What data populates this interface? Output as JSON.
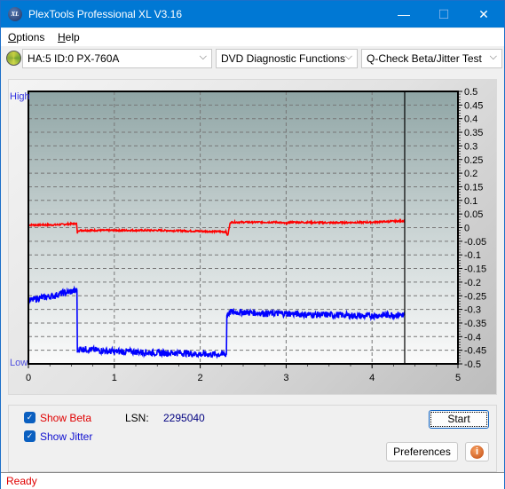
{
  "window": {
    "title": "PlexTools Professional XL V3.16",
    "icon_label": "XL",
    "minimize_glyph": "—",
    "maximize_glyph": "☐",
    "close_glyph": "✕"
  },
  "menu": {
    "items": [
      {
        "label": "Options",
        "accel": "O",
        "rest": "ptions"
      },
      {
        "label": "Help",
        "accel": "H",
        "rest": "elp"
      }
    ]
  },
  "toolbar": {
    "drive_select": "HA:5 ID:0  PX-760A",
    "function_select": "DVD Diagnostic Functions",
    "test_select": "Q-Check Beta/Jitter Test",
    "chevron": "⌵"
  },
  "chart_data": {
    "type": "line",
    "title": "",
    "xlabel": "",
    "ylabel": "",
    "left_label_high": "High",
    "left_label_low": "Low",
    "xlim": [
      0,
      5
    ],
    "ylim": [
      -0.5,
      0.5
    ],
    "x_ticks": [
      "0",
      "1",
      "2",
      "3",
      "4",
      "5"
    ],
    "y_ticks": [
      "0.5",
      "0.45",
      "0.4",
      "0.35",
      "0.3",
      "0.25",
      "0.2",
      "0.15",
      "0.1",
      "0.05",
      "0",
      "-0.05",
      "-0.1",
      "-0.15",
      "-0.2",
      "-0.25",
      "-0.3",
      "-0.35",
      "-0.4",
      "-0.45",
      "-0.5"
    ],
    "grid": true,
    "cursor_x": 4.38,
    "series": [
      {
        "name": "Beta",
        "color": "#ff0000",
        "x": [
          0.0,
          0.3,
          0.56,
          0.57,
          0.58,
          1.0,
          1.5,
          2.0,
          2.3,
          2.32,
          2.35,
          2.5,
          2.9,
          3.0,
          3.05,
          3.5,
          4.0,
          4.38
        ],
        "y": [
          0.01,
          0.01,
          0.015,
          -0.02,
          -0.01,
          -0.01,
          -0.01,
          -0.013,
          -0.015,
          -0.03,
          0.02,
          0.02,
          0.02,
          0.015,
          0.02,
          0.018,
          0.02,
          0.025
        ]
      },
      {
        "name": "Jitter",
        "color": "#0000ff",
        "x": [
          0.0,
          0.1,
          0.2,
          0.3,
          0.4,
          0.5,
          0.56,
          0.57,
          0.6,
          0.8,
          1.0,
          1.2,
          1.5,
          1.8,
          2.0,
          2.2,
          2.3,
          2.31,
          2.35,
          2.5,
          2.8,
          3.0,
          3.3,
          3.6,
          3.9,
          4.2,
          4.38
        ],
        "y": [
          -0.27,
          -0.26,
          -0.255,
          -0.25,
          -0.24,
          -0.235,
          -0.23,
          -0.45,
          -0.445,
          -0.45,
          -0.455,
          -0.455,
          -0.46,
          -0.46,
          -0.465,
          -0.465,
          -0.465,
          -0.32,
          -0.31,
          -0.31,
          -0.315,
          -0.315,
          -0.32,
          -0.32,
          -0.325,
          -0.32,
          -0.32
        ]
      }
    ]
  },
  "controls": {
    "show_beta_label": "Show Beta",
    "show_beta_checked": true,
    "show_jitter_label": "Show Jitter",
    "show_jitter_checked": true,
    "lsn_label": "LSN:",
    "lsn_value": "2295040",
    "start_label": "Start",
    "preferences_label": "Preferences",
    "info_glyph": "i"
  },
  "status": {
    "text": "Ready"
  }
}
